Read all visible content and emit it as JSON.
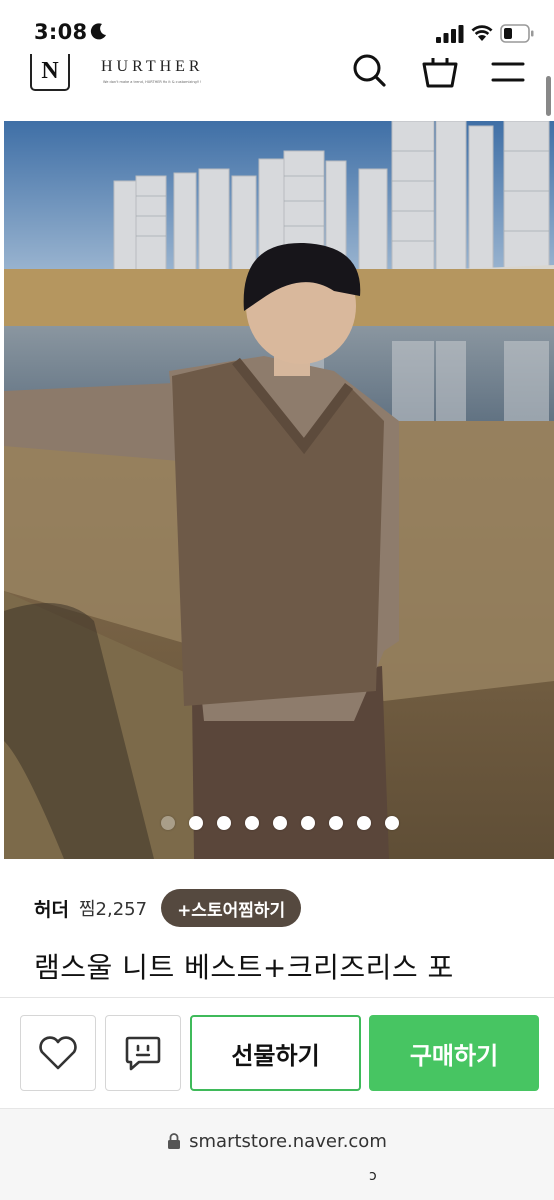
{
  "status_bar": {
    "time": "3:08",
    "icons": [
      "moon-icon",
      "cellular-signal-icon",
      "wifi-icon",
      "battery-icon"
    ]
  },
  "header": {
    "logo_letter": "N",
    "brand_name": "HURTHER",
    "brand_tagline": "We don't make a trend, HURTHER fix it & customizing!!!",
    "icons": [
      "search-icon",
      "shopping-bag-icon",
      "hamburger-menu-icon"
    ]
  },
  "gallery": {
    "total_images": 9,
    "current_index": 1
  },
  "product": {
    "store_name": "허더",
    "like_label": "찜2,257",
    "follow_label": "+스토어찜하기",
    "title": "램스울 니트 베스트+크리즈리스 포"
  },
  "actions": {
    "wish_icon": "heart-icon",
    "talk_icon": "talk-chat-icon",
    "gift_label": "선물하기",
    "buy_label": "구매하기"
  },
  "browser": {
    "url": "smartstore.naver.com",
    "lock_icon": "lock-icon",
    "bottom_glyph": "ↄ"
  },
  "colors": {
    "buy_green": "#47c562",
    "gift_border": "#3fba5a",
    "follow_bg": "#55493f"
  }
}
